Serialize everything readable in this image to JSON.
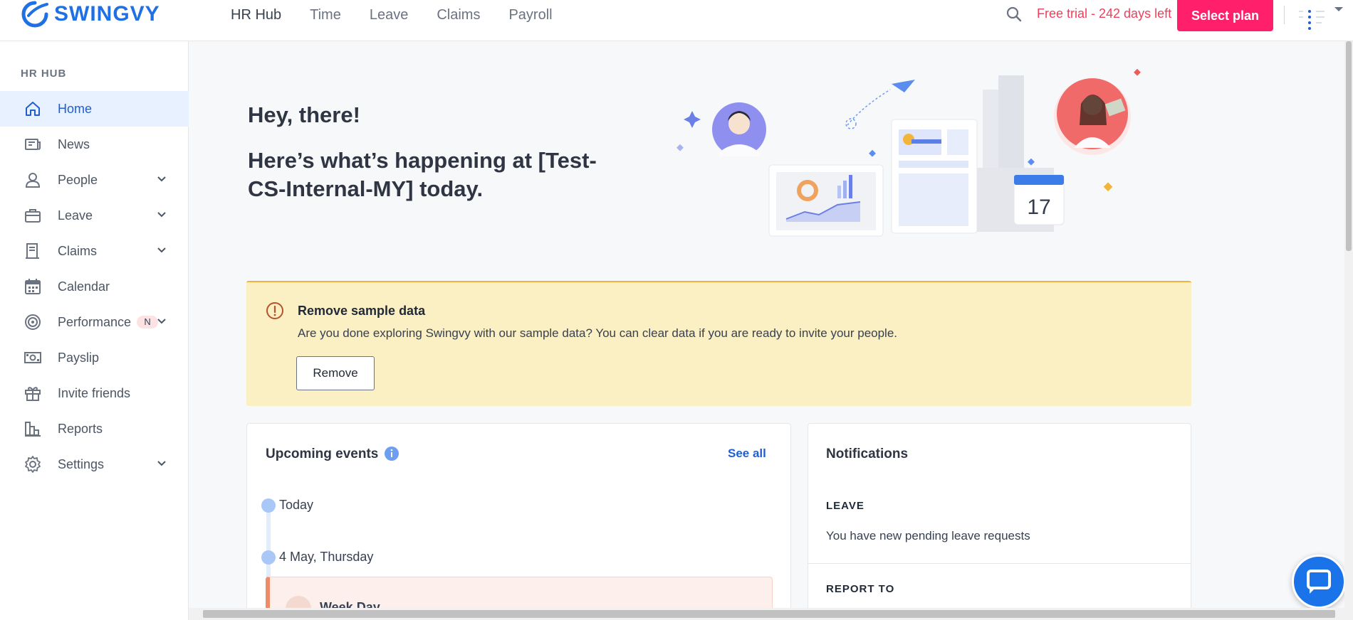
{
  "brand": {
    "name": "SWINGVY",
    "color": "#1f6fe5"
  },
  "topnav": {
    "items": [
      "HR Hub",
      "Time",
      "Leave",
      "Claims",
      "Payroll"
    ]
  },
  "trial": {
    "text": "Free trial - 242 days left",
    "color": "#ef3e5c"
  },
  "select_plan": {
    "label": "Select plan",
    "color": "#ff1f6b"
  },
  "sidebar": {
    "heading": "HR HUB",
    "items": [
      {
        "label": "Home",
        "icon": "home-icon",
        "active": true
      },
      {
        "label": "News",
        "icon": "news-icon"
      },
      {
        "label": "People",
        "icon": "person-icon",
        "expandable": true
      },
      {
        "label": "Leave",
        "icon": "briefcase-icon",
        "expandable": true
      },
      {
        "label": "Claims",
        "icon": "receipt-icon",
        "expandable": true
      },
      {
        "label": "Calendar",
        "icon": "calendar-icon"
      },
      {
        "label": "Performance",
        "icon": "target-icon",
        "badge": "N",
        "expandable": true
      },
      {
        "label": "Payslip",
        "icon": "money-icon"
      },
      {
        "label": "Invite friends",
        "icon": "gift-icon"
      },
      {
        "label": "Reports",
        "icon": "bar-chart-icon"
      },
      {
        "label": "Settings",
        "icon": "gear-icon",
        "expandable": true
      }
    ]
  },
  "greeting": {
    "line1": "Hey, there!",
    "line2": "Here’s what’s happening at [Test-CS-Internal-MY] today.",
    "calendar_day": "17"
  },
  "alert": {
    "title": "Remove sample data",
    "text": "Are you done exploring Swingvy with our sample data? You can clear data if you are ready to invite your people.",
    "button": "Remove"
  },
  "events": {
    "title": "Upcoming events",
    "see_all": "See all",
    "groups": [
      "Today",
      "4 May, Thursday"
    ],
    "item": "Week Day"
  },
  "notifications": {
    "title": "Notifications",
    "sections": [
      {
        "heading": "LEAVE",
        "text": "You have new pending leave requests"
      },
      {
        "heading": "REPORT TO"
      }
    ]
  }
}
